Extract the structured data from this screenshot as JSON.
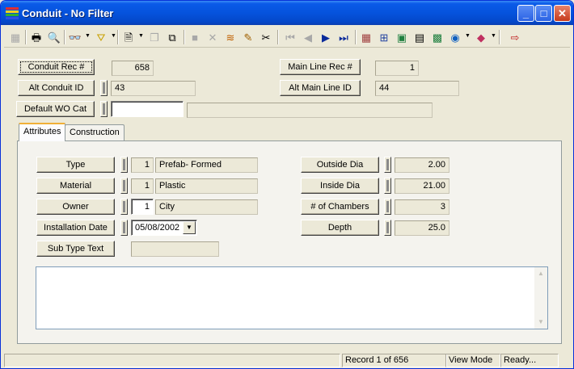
{
  "window": {
    "title": "Conduit - No Filter",
    "controls": [
      "_",
      "□",
      "✕"
    ]
  },
  "toolbar": {
    "icons": [
      "table-icon",
      "print-icon",
      "print-preview-icon",
      "binoculars-icon",
      "filter-icon",
      "form-icon",
      "copy-record-icon",
      "duplicate-icon",
      "save-icon",
      "delete-icon",
      "stack-icon",
      "pencil-icon",
      "scissors-icon",
      "first-record-icon",
      "prev-record-icon",
      "next-record-icon",
      "last-record-icon",
      "grid-icon",
      "tree-icon",
      "image-icon",
      "calculator-icon",
      "map-icon",
      "globe-icon",
      "book-icon",
      "exit-icon"
    ]
  },
  "header": {
    "conduit_rec_label": "Conduit Rec #",
    "conduit_rec_value": "658",
    "main_line_rec_label": "Main Line Rec #",
    "main_line_rec_value": "1",
    "alt_conduit_label": "Alt Conduit ID",
    "alt_conduit_value": "43",
    "alt_main_line_label": "Alt Main Line ID",
    "alt_main_line_value": "44",
    "default_wo_label": "Default WO Cat",
    "default_wo_value": "",
    "default_wo_desc": ""
  },
  "tabs": [
    "Attributes",
    "Construction"
  ],
  "attributes": {
    "type_label": "Type",
    "type_code": "1",
    "type_desc": "Prefab- Formed",
    "material_label": "Material",
    "material_code": "1",
    "material_desc": "Plastic",
    "owner_label": "Owner",
    "owner_code": "1",
    "owner_desc": "City",
    "install_label": "Installation Date",
    "install_value": "05/08/2002",
    "subtype_label": "Sub Type Text",
    "subtype_value": "",
    "outside_label": "Outside Dia",
    "outside_value": "2.00",
    "inside_label": "Inside Dia",
    "inside_value": "21.00",
    "chambers_label": "# of Chambers",
    "chambers_value": "3",
    "depth_label": "Depth",
    "depth_value": "25.0",
    "memo": ""
  },
  "status": {
    "main": "",
    "record": "Record 1 of 656",
    "mode": "View Mode",
    "state": "Ready..."
  }
}
